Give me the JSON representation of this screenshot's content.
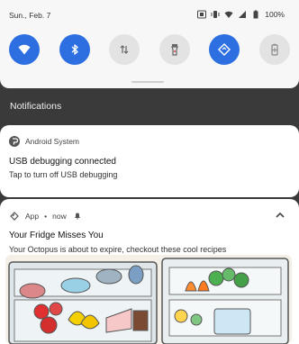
{
  "status_bar": {
    "date": "Sun., Feb. 7",
    "battery": "100%"
  },
  "quick_settings": {
    "tiles": [
      {
        "name": "wifi-tile",
        "state": "on",
        "icon": "wifi-icon"
      },
      {
        "name": "bluetooth-tile",
        "state": "on",
        "icon": "bluetooth-icon"
      },
      {
        "name": "data-tile",
        "state": "off",
        "icon": "data-transfer-icon"
      },
      {
        "name": "flashlight-tile",
        "state": "off",
        "icon": "flashlight-icon"
      },
      {
        "name": "auto-rotate-tile",
        "state": "on",
        "icon": "rotate-icon"
      },
      {
        "name": "battery-saver-tile",
        "state": "off",
        "icon": "battery-saver-icon"
      }
    ]
  },
  "notifications_header": {
    "title": "Notifications"
  },
  "notification1": {
    "app_name": "Android System",
    "title": "USB debugging connected",
    "body": "Tap to turn off USB debugging"
  },
  "notification2": {
    "app_name": "App",
    "time": "now",
    "title": "Your Fridge Misses You",
    "body": "Your Octopus is about to expire, checkout these cool recipes"
  },
  "colors": {
    "accent": "#2d6fe0",
    "panel_bg": "#f7f7f7",
    "shade_bg": "#3a3a3a",
    "card_bg": "#ffffff"
  }
}
